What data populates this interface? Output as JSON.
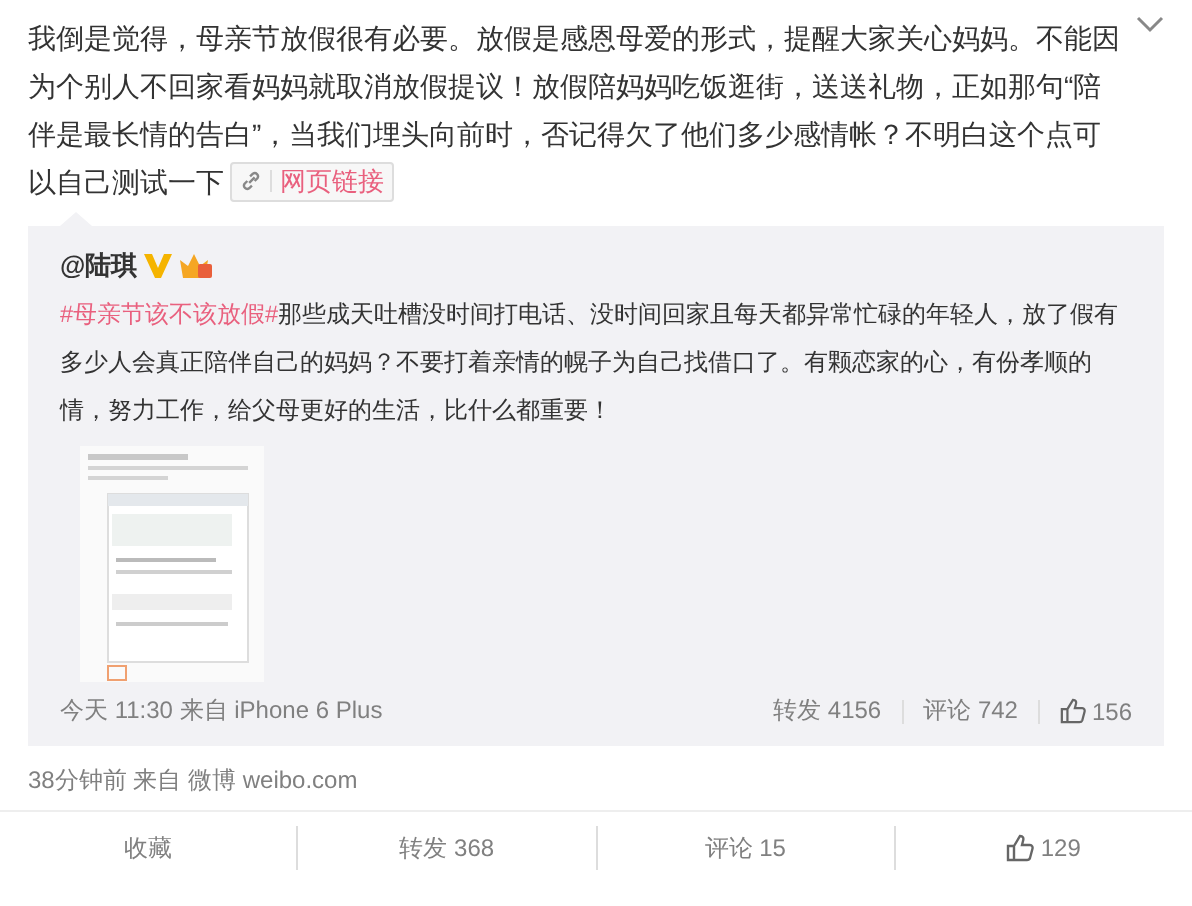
{
  "post": {
    "text": "我倒是觉得，母亲节放假很有必要。放假是感恩母爱的形式，提醒大家关心妈妈。不能因为个别人不回家看妈妈就取消放假提议！放假陪妈妈吃饭逛街，送送礼物，正如那句“陪伴是最长情的告白”，当我们埋头向前时，否记得欠了他们多少感情帐？不明白这个点可以自己测试一下",
    "link": {
      "label": "网页链接"
    }
  },
  "repost": {
    "author": "@陆琪",
    "hashtag": "#母亲节该不该放假#",
    "text": "那些成天吐槽没时间打电话、没时间回家且每天都异常忙碌的年轻人，放了假有多少人会真正陪伴自己的妈妈？不要打着亲情的幌子为自己找借口了。有颗恋家的心，有份孝顺的情，努力工作，给父母更好的生活，比什么都重要！",
    "time": "今天 11:30 来自 iPhone 6 Plus",
    "stats": [
      {
        "kind": "repost",
        "label": "转发 4156"
      },
      {
        "kind": "comment",
        "label": "评论 742"
      },
      {
        "kind": "like",
        "label": "156"
      }
    ]
  },
  "meta": "38分钟前 来自 微博 weibo.com",
  "actions": [
    {
      "kind": "favorite",
      "label": "收藏"
    },
    {
      "kind": "repost",
      "label": "转发 368"
    },
    {
      "kind": "comment",
      "label": "评论 15"
    },
    {
      "kind": "like",
      "label": "129"
    }
  ]
}
